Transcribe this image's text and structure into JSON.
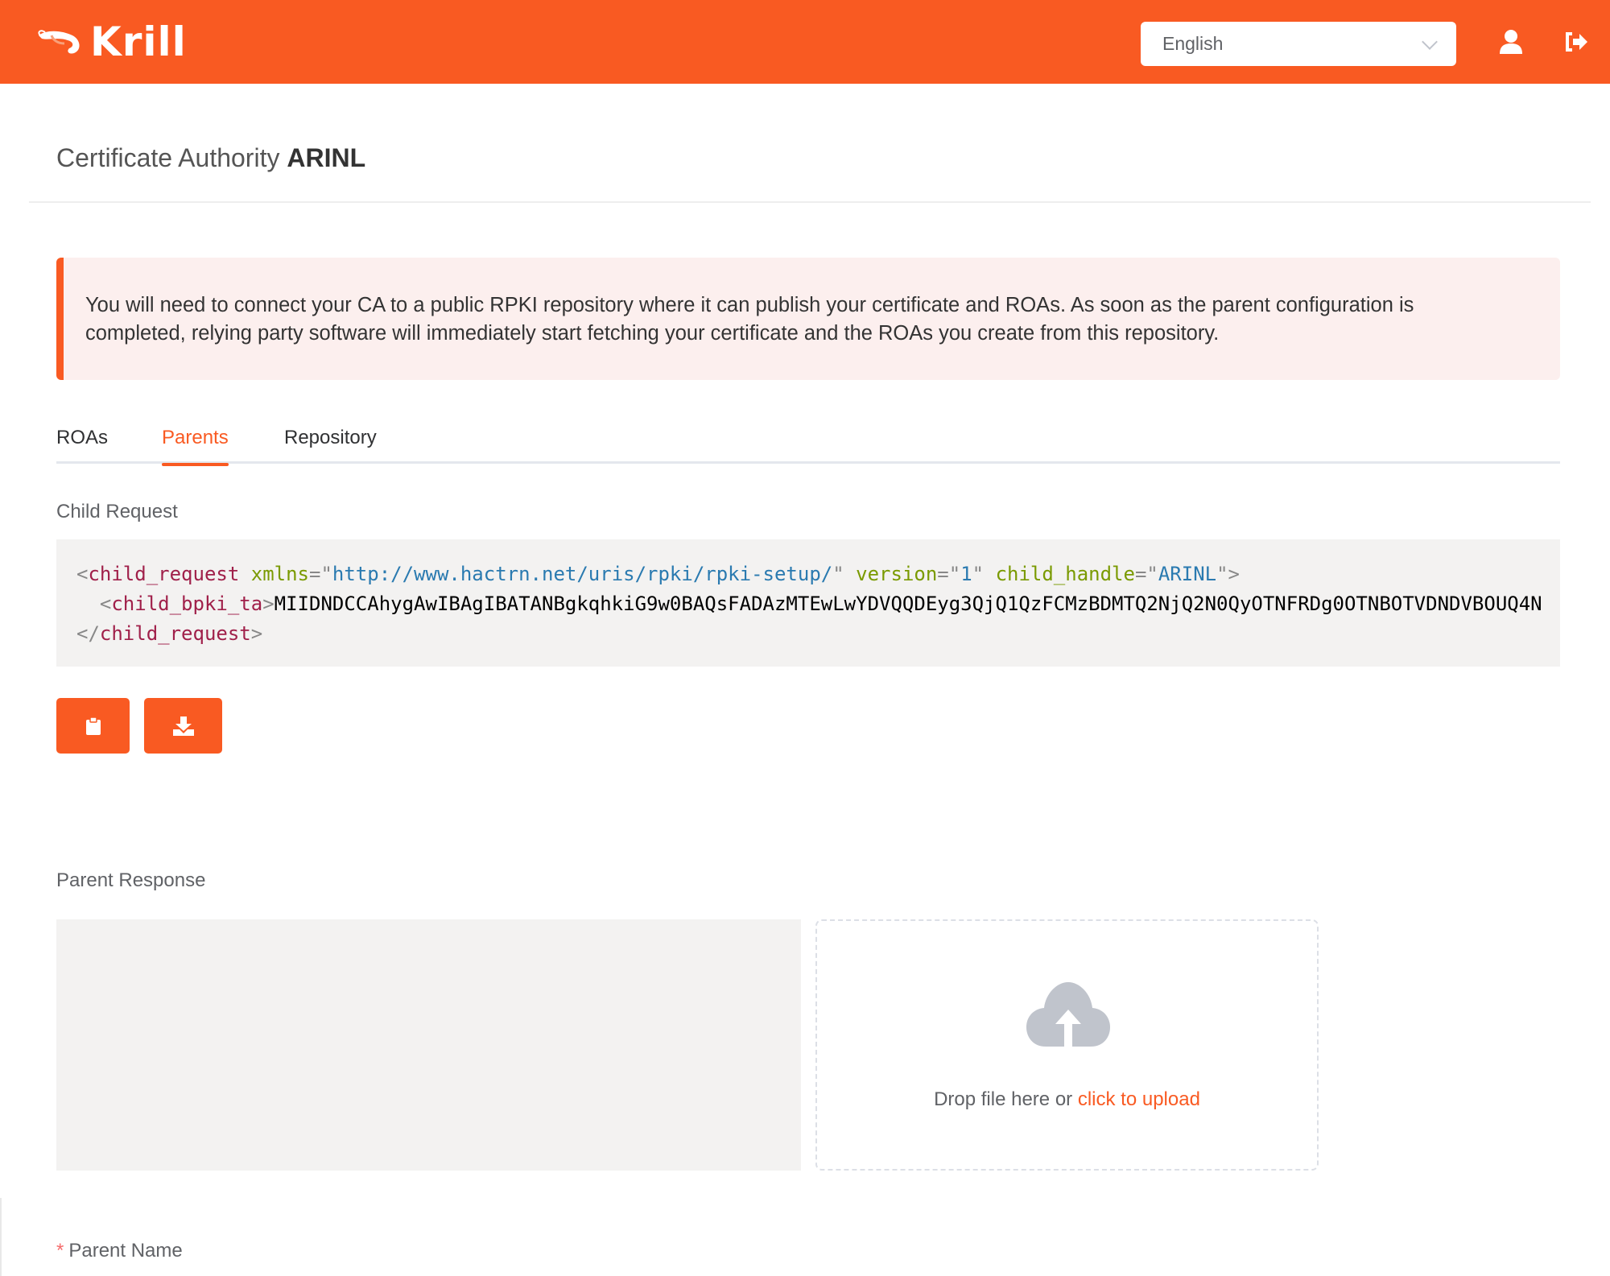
{
  "header": {
    "brand": "Krill",
    "language": {
      "selected": "English"
    },
    "icons": {
      "user": "user-icon",
      "logout": "logout-icon",
      "logo": "shrimp-logo-icon",
      "dropdown": "chevron-down-icon"
    },
    "colors": {
      "brand": "#f95a22"
    }
  },
  "page": {
    "title_prefix": "Certificate Authority",
    "title_ca": "ARINL"
  },
  "alert": {
    "text": "You will need to connect your CA to a public RPKI repository where it can publish your certificate and ROAs. As soon as the parent configuration is completed, relying party software will immediately start fetching your certificate and the ROAs you create from this repository."
  },
  "tabs": [
    {
      "label": "ROAs",
      "active": false
    },
    {
      "label": "Parents",
      "active": true
    },
    {
      "label": "Repository",
      "active": false
    }
  ],
  "child_request": {
    "label": "Child Request",
    "xml": {
      "root_tag": "child_request",
      "xmlns_attr": "xmlns",
      "xmlns_value": "http://www.hactrn.net/uris/rpki/rpki-setup/",
      "version_attr": "version",
      "version_value": "1",
      "handle_attr": "child_handle",
      "handle_value": "ARINL",
      "child_tag": "child_bpki_ta",
      "child_value": "MIIDNDCCAhygAwIBAgIBATANBgkqhkiG9w0BAQsFADAzMTEwLwYDVQQDEyg3QjQ1QzFCMzBDMTQ2NjQ2N0QyOTNFRDg0OTNBOTVDNDVBOUQ4N"
    },
    "buttons": {
      "copy": {
        "icon": "clipboard-icon"
      },
      "download": {
        "icon": "download-icon"
      }
    }
  },
  "parent_response": {
    "label": "Parent Response",
    "textarea_value": "",
    "upload": {
      "icon": "cloud-upload-icon",
      "text": "Drop file here or",
      "link": "click to upload"
    }
  },
  "form": {
    "parent_name_label": "Parent Name",
    "required_marker": "*"
  }
}
